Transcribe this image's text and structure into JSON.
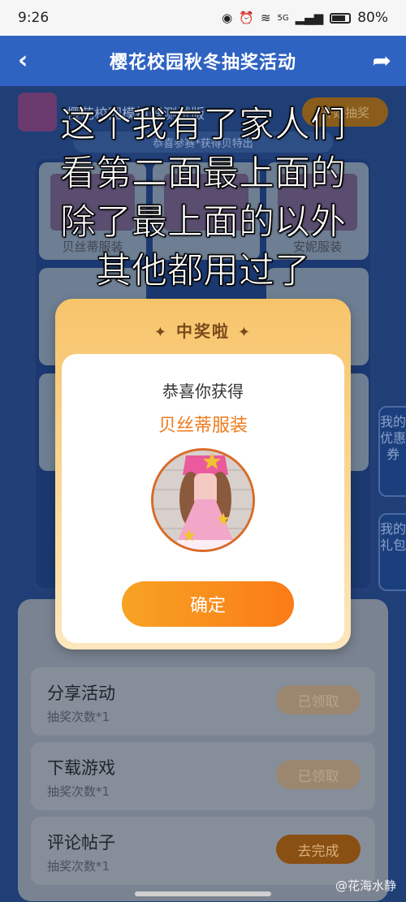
{
  "status_bar": {
    "time": "9:26",
    "battery": "80%",
    "icons": [
      "eye-icon",
      "alarm-icon",
      "wifi-icon",
      "signal-icon",
      "battery-icon"
    ],
    "network": "5G"
  },
  "header": {
    "title": "樱花校园秋冬抽奖活动",
    "back_icon": "back-arrow-icon",
    "share_icon": "share-icon"
  },
  "page": {
    "app_name": "樱花校园模拟器测试版",
    "start_button": "开始抽奖",
    "notice": "恭喜参赛*获得贝特出",
    "grid_cells": [
      {
        "label": "贝丝蒂服装"
      },
      {
        "label": ""
      },
      {
        "label": "安妮服装"
      }
    ],
    "side_tabs": [
      {
        "label": "我的优惠券"
      },
      {
        "label": "我的礼包"
      }
    ],
    "tasks": [
      {
        "name": "分享活动",
        "sub": "抽奖次数*1",
        "button": "已领取",
        "state": "done"
      },
      {
        "name": "下载游戏",
        "sub": "抽奖次数*1",
        "button": "已领取",
        "state": "done"
      },
      {
        "name": "评论帖子",
        "sub": "抽奖次数*1",
        "button": "去完成",
        "state": "todo"
      }
    ]
  },
  "dialog": {
    "title": "中奖啦",
    "congrats": "恭喜你获得",
    "prize": "贝丝蒂服装",
    "confirm": "确定"
  },
  "caption_lines": [
    "这个我有了家人们",
    "看第二面最上面的",
    "除了最上面的以外",
    "其他都用过了"
  ],
  "watermark": "@花海水静",
  "colors": {
    "header": "#2f63c2",
    "accent": "#ef7b1c",
    "confirm_gradient": [
      "#f7a324",
      "#fb7b17"
    ]
  }
}
